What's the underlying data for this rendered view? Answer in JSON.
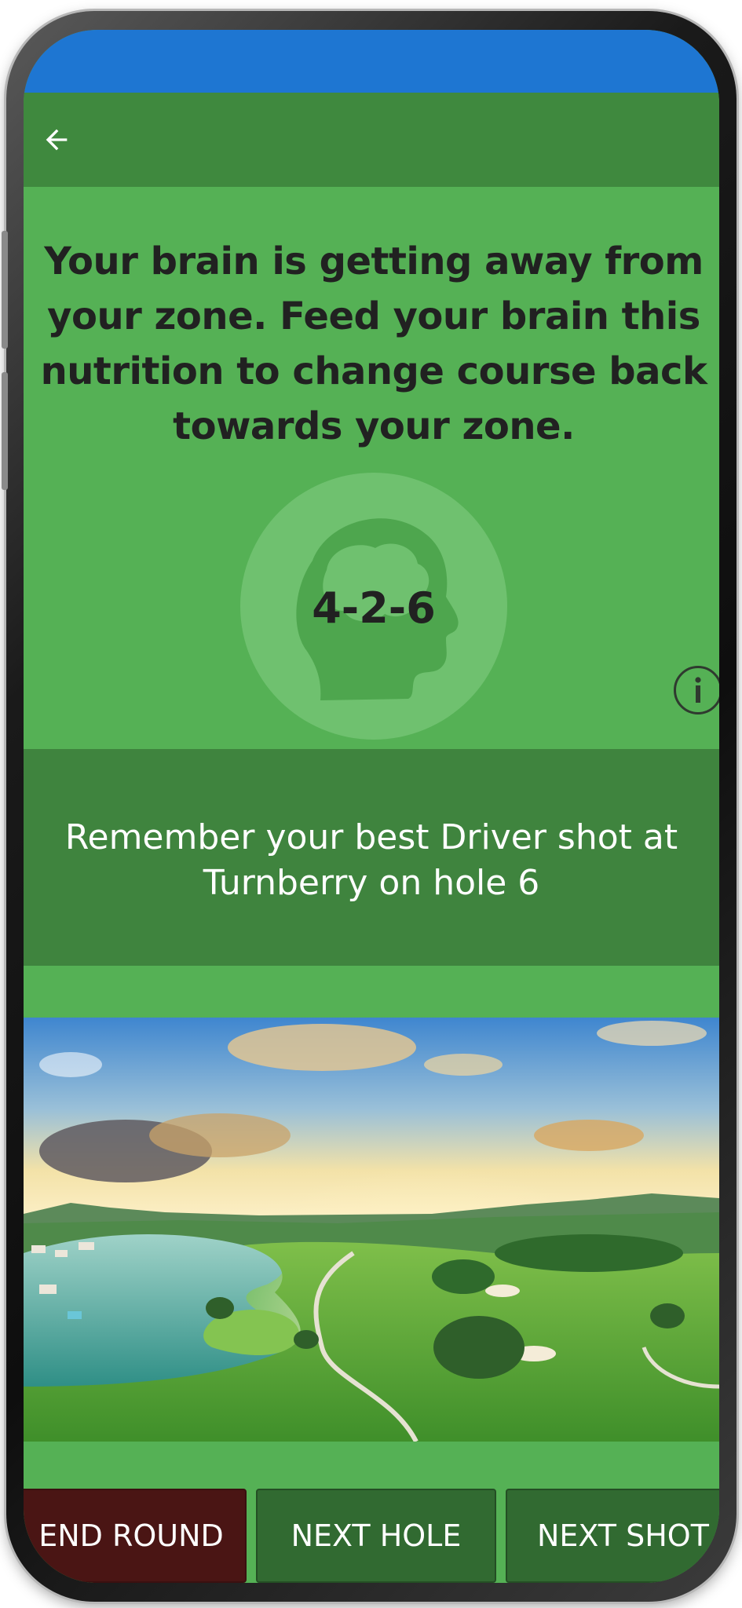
{
  "colors": {
    "status_bar": "#1e76d2",
    "app_bar": "#3f893e",
    "background": "#55b155",
    "memory_panel": "#3f843e",
    "end_round_button": "#4a1514",
    "secondary_button": "#316a31"
  },
  "app_bar": {
    "back_icon": "arrow-left-icon"
  },
  "zone": {
    "message": "Your brain is getting away from your zone. Feed your brain this nutrition to change course back towards your zone.",
    "brain_icon": "head-brain-icon",
    "code": "4-2-6",
    "info_icon": "info-icon"
  },
  "memory": {
    "text": "Remember your best Driver shot at Turnberry on hole 6"
  },
  "photo": {
    "subject": "golf course with lake at sunset"
  },
  "buttons": {
    "end_round": "END ROUND",
    "next_hole": "NEXT HOLE",
    "next_shot": "NEXT SHOT"
  }
}
